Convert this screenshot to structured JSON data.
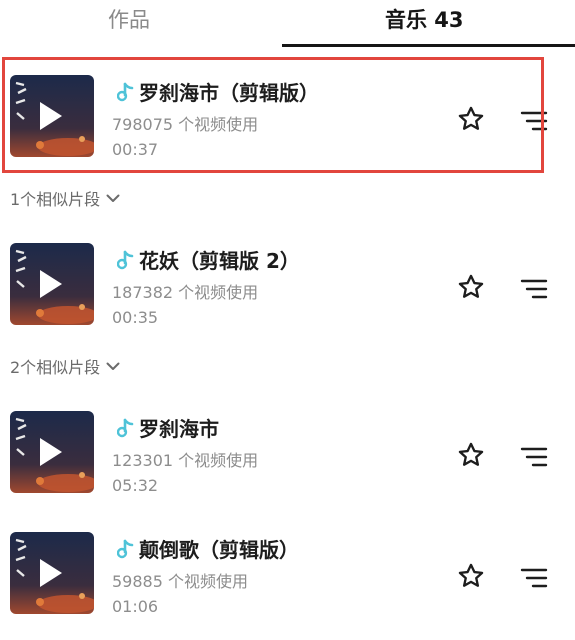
{
  "tabs": [
    {
      "label": "作品",
      "active": false
    },
    {
      "label": "音乐 43",
      "active": true
    }
  ],
  "tracks": [
    {
      "title": "罗刹海市（剪辑版）",
      "usage": "798075 个视频使用",
      "duration": "00:37",
      "highlighted": true
    },
    {
      "title": "花妖（剪辑版 2）",
      "usage": "187382 个视频使用",
      "duration": "00:35",
      "highlighted": false
    },
    {
      "title": "罗刹海市",
      "usage": "123301 个视频使用",
      "duration": "05:32",
      "highlighted": false
    },
    {
      "title": "颠倒歌（剪辑版）",
      "usage": "59885 个视频使用",
      "duration": "01:06",
      "highlighted": false
    }
  ],
  "similar_segments": [
    {
      "label": "1个相似片段"
    },
    {
      "label": "2个相似片段"
    }
  ],
  "icons": {
    "note": "music-note-icon",
    "play": "play-icon",
    "favorite": "star-icon",
    "menu": "list-menu-icon",
    "expand": "chevron-down-icon"
  },
  "colors": {
    "note_accent": "#4fc3d8",
    "highlight_border": "#e2463d"
  }
}
